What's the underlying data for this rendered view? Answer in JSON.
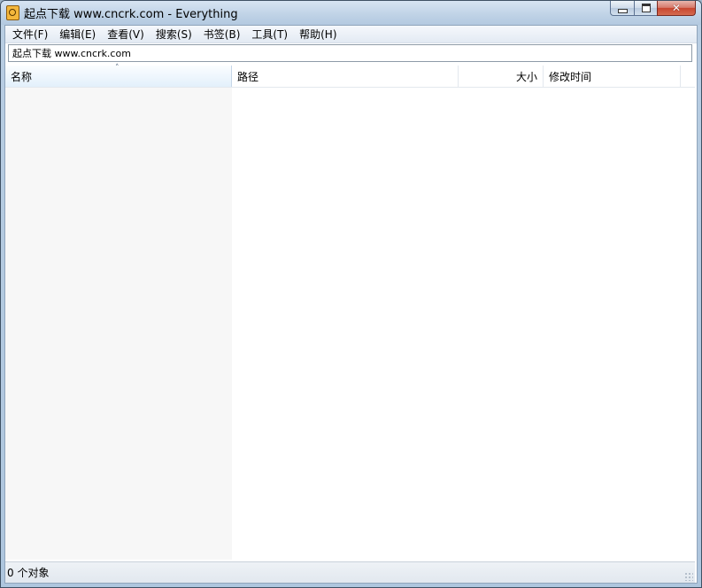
{
  "window": {
    "title": "起点下载 www.cncrk.com - Everything"
  },
  "menu": {
    "items": [
      {
        "label": "文件(F)"
      },
      {
        "label": "编辑(E)"
      },
      {
        "label": "查看(V)"
      },
      {
        "label": "搜索(S)"
      },
      {
        "label": "书签(B)"
      },
      {
        "label": "工具(T)"
      },
      {
        "label": "帮助(H)"
      }
    ]
  },
  "search": {
    "value": "起点下载 www.cncrk.com"
  },
  "columns": {
    "name": "名称",
    "path": "路径",
    "size": "大小",
    "modified": "修改时间"
  },
  "status": {
    "text": "0 个对象"
  },
  "icons": {
    "app": "everything-app-icon",
    "minimize": "minimize-icon",
    "maximize": "maximize-icon",
    "close": "close-icon",
    "sort": "sort-ascending-icon"
  }
}
